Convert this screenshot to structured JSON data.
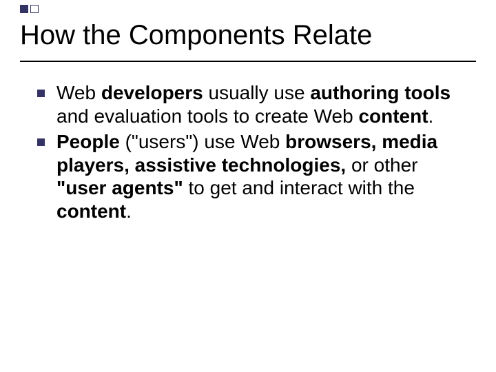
{
  "slide": {
    "title": "How the Components Relate",
    "bullets": [
      {
        "runs": [
          {
            "t": "Web ",
            "b": false
          },
          {
            "t": "developers",
            "b": true
          },
          {
            "t": " usually use ",
            "b": false
          },
          {
            "t": "authoring tools",
            "b": true
          },
          {
            "t": " and evaluation tools to create Web ",
            "b": false
          },
          {
            "t": "content",
            "b": true
          },
          {
            "t": ".",
            "b": false
          }
        ]
      },
      {
        "runs": [
          {
            "t": "People",
            "b": true
          },
          {
            "t": " (\"users\") use Web ",
            "b": false
          },
          {
            "t": "browsers, media players, assistive technologies,",
            "b": true
          },
          {
            "t": " or other ",
            "b": false
          },
          {
            "t": "\"user agents\"",
            "b": true
          },
          {
            "t": " to get and interact with the ",
            "b": false
          },
          {
            "t": "content",
            "b": true
          },
          {
            "t": ".",
            "b": false
          }
        ]
      }
    ],
    "accent_color": "#333366"
  }
}
